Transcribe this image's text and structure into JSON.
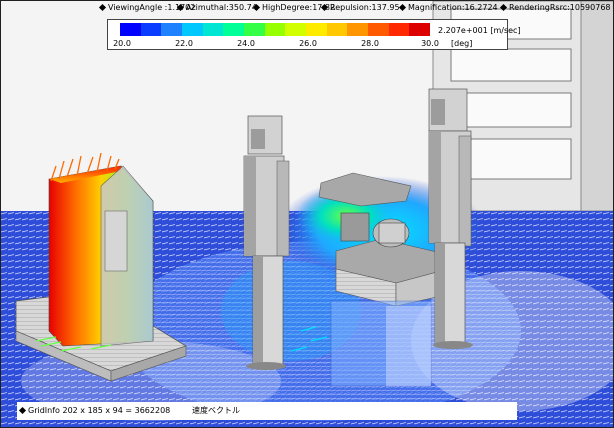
{
  "stats": {
    "viewing_angle": "ViewingAngle :1.1702",
    "azimuthal": "Azimuthal:350.74",
    "high_degree": "HighDegree:17.82",
    "repulsion": "Repulsion:137.95",
    "magnification": "Magnification:16.2724",
    "rendering": "RenderingRsrc:10590768"
  },
  "legend": {
    "max_label": "2.207e+001 [m/sec]",
    "unit_label": "[deg]",
    "ticks": [
      "20.0",
      "22.0",
      "24.0",
      "26.0",
      "28.0",
      "30.0"
    ],
    "colors": [
      "#0000ff",
      "#0a3cff",
      "#1e82ff",
      "#00c8ff",
      "#00e6d2",
      "#00ff96",
      "#32ff46",
      "#96ff00",
      "#d2ff00",
      "#ffeb00",
      "#ffc800",
      "#ff9600",
      "#ff5a00",
      "#ff2800",
      "#dc0000"
    ]
  },
  "footer": {
    "grid_info": "GridInfo  202 x 185 x 94 = 3662208",
    "mode_label": "速度ベクトル"
  }
}
